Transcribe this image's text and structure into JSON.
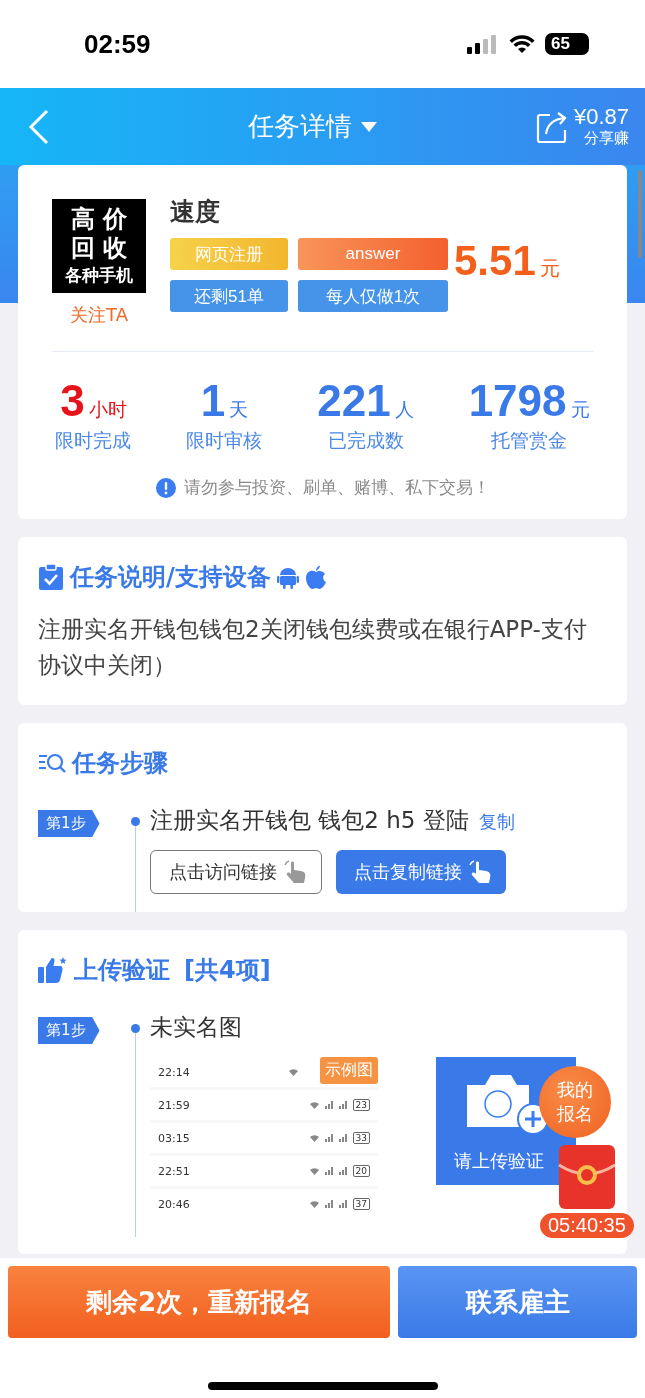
{
  "status_bar": {
    "time": "02:59",
    "battery": "65"
  },
  "header": {
    "title": "任务详情",
    "share_amount": "¥0.87",
    "share_label": "分享赚"
  },
  "task": {
    "logo_lines": [
      "高 价",
      "回 收",
      "各种手机"
    ],
    "follow": "关注TA",
    "name": "速度",
    "tags": [
      {
        "label": "网页注册",
        "kind": "yellow"
      },
      {
        "label": "answer",
        "kind": "orange"
      },
      {
        "label": "还剩51单",
        "kind": "blue"
      },
      {
        "label": "每人仅做1次",
        "kind": "blue"
      }
    ],
    "price": "5.51",
    "price_unit": "元",
    "stats": [
      {
        "value": "3",
        "unit": "小时",
        "label": "限时完成",
        "kind": "red"
      },
      {
        "value": "1",
        "unit": "天",
        "label": "限时审核",
        "kind": "blue"
      },
      {
        "value": "221",
        "unit": "人",
        "label": "已完成数",
        "kind": "blue"
      },
      {
        "value": "1798",
        "unit": "元",
        "label": "托管赏金",
        "kind": "blue"
      }
    ],
    "warning": "请勿参与投资、刷单、赌博、私下交易！"
  },
  "description": {
    "title": "任务说明/支持设备",
    "text": "注册实名开钱包钱包2关闭钱包续费或在银行APP-支付协议中关闭）"
  },
  "steps": {
    "title": "任务步骤",
    "items": [
      {
        "badge": "第1步",
        "text": "注册实名开钱包 钱包2 h5 登陆",
        "copy": "复制",
        "buttons": [
          {
            "label": "点击访问链接",
            "kind": "outline"
          },
          {
            "label": "点击复制链接",
            "kind": "filled"
          }
        ]
      }
    ]
  },
  "upload": {
    "title": "上传验证",
    "count": "[共4项]",
    "items": [
      {
        "badge": "第1步",
        "text": "未实名图",
        "example_label": "示例图",
        "example_rows": [
          {
            "time": "22:14"
          },
          {
            "time": "21:59",
            "battery": "23"
          },
          {
            "time": "03:15",
            "battery": "33"
          },
          {
            "time": "22:51",
            "battery": "20"
          },
          {
            "time": "20:46",
            "battery": "37"
          }
        ],
        "upload_label": "请上传验证"
      }
    ]
  },
  "floating": {
    "signup": "我的报名",
    "timer": "05:40:35"
  },
  "bottom_buttons": [
    {
      "label": "剩余2次，重新报名",
      "kind": "orange"
    },
    {
      "label": "联系雇主",
      "kind": "blue"
    }
  ]
}
